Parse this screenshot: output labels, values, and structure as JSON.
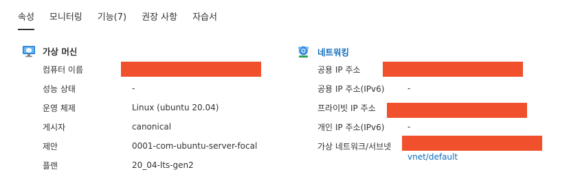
{
  "tabs": [
    {
      "label": "속성",
      "active": true
    },
    {
      "label": "모니터링",
      "active": false
    },
    {
      "label": "기능(7)",
      "active": false
    },
    {
      "label": "권장 사항",
      "active": false
    },
    {
      "label": "자습서",
      "active": false
    }
  ],
  "vm_section": {
    "title": "가상 머신",
    "icon": "virtual-machine-icon",
    "rows": [
      {
        "label": "컴퓨터 이름",
        "value": "",
        "redacted": true
      },
      {
        "label": "성능 상태",
        "value": "-"
      },
      {
        "label": "운영 체제",
        "value": "Linux (ubuntu 20.04)"
      },
      {
        "label": "게시자",
        "value": "canonical"
      },
      {
        "label": "제안",
        "value": "0001-com-ubuntu-server-focal"
      },
      {
        "label": "플랜",
        "value": "20_04-lts-gen2"
      }
    ]
  },
  "network_section": {
    "title": "네트워킹",
    "icon": "networking-icon",
    "rows": [
      {
        "label": "공용 IP 주소",
        "value": "",
        "redacted": true
      },
      {
        "label": "공용 IP 주소(IPv6)",
        "value": "-"
      },
      {
        "label": "프라이빗 IP 주소",
        "value": "",
        "redacted": true
      },
      {
        "label": "개인 IP 주소(IPv6)",
        "value": "-"
      },
      {
        "label": "가상 네트워크/서브넷",
        "value": "",
        "redacted": true
      },
      {
        "label": "",
        "value": "vnet/default"
      }
    ]
  },
  "colors": {
    "accent": "#0f6cbd",
    "redaction": "#f0502b",
    "text": "#323130"
  }
}
